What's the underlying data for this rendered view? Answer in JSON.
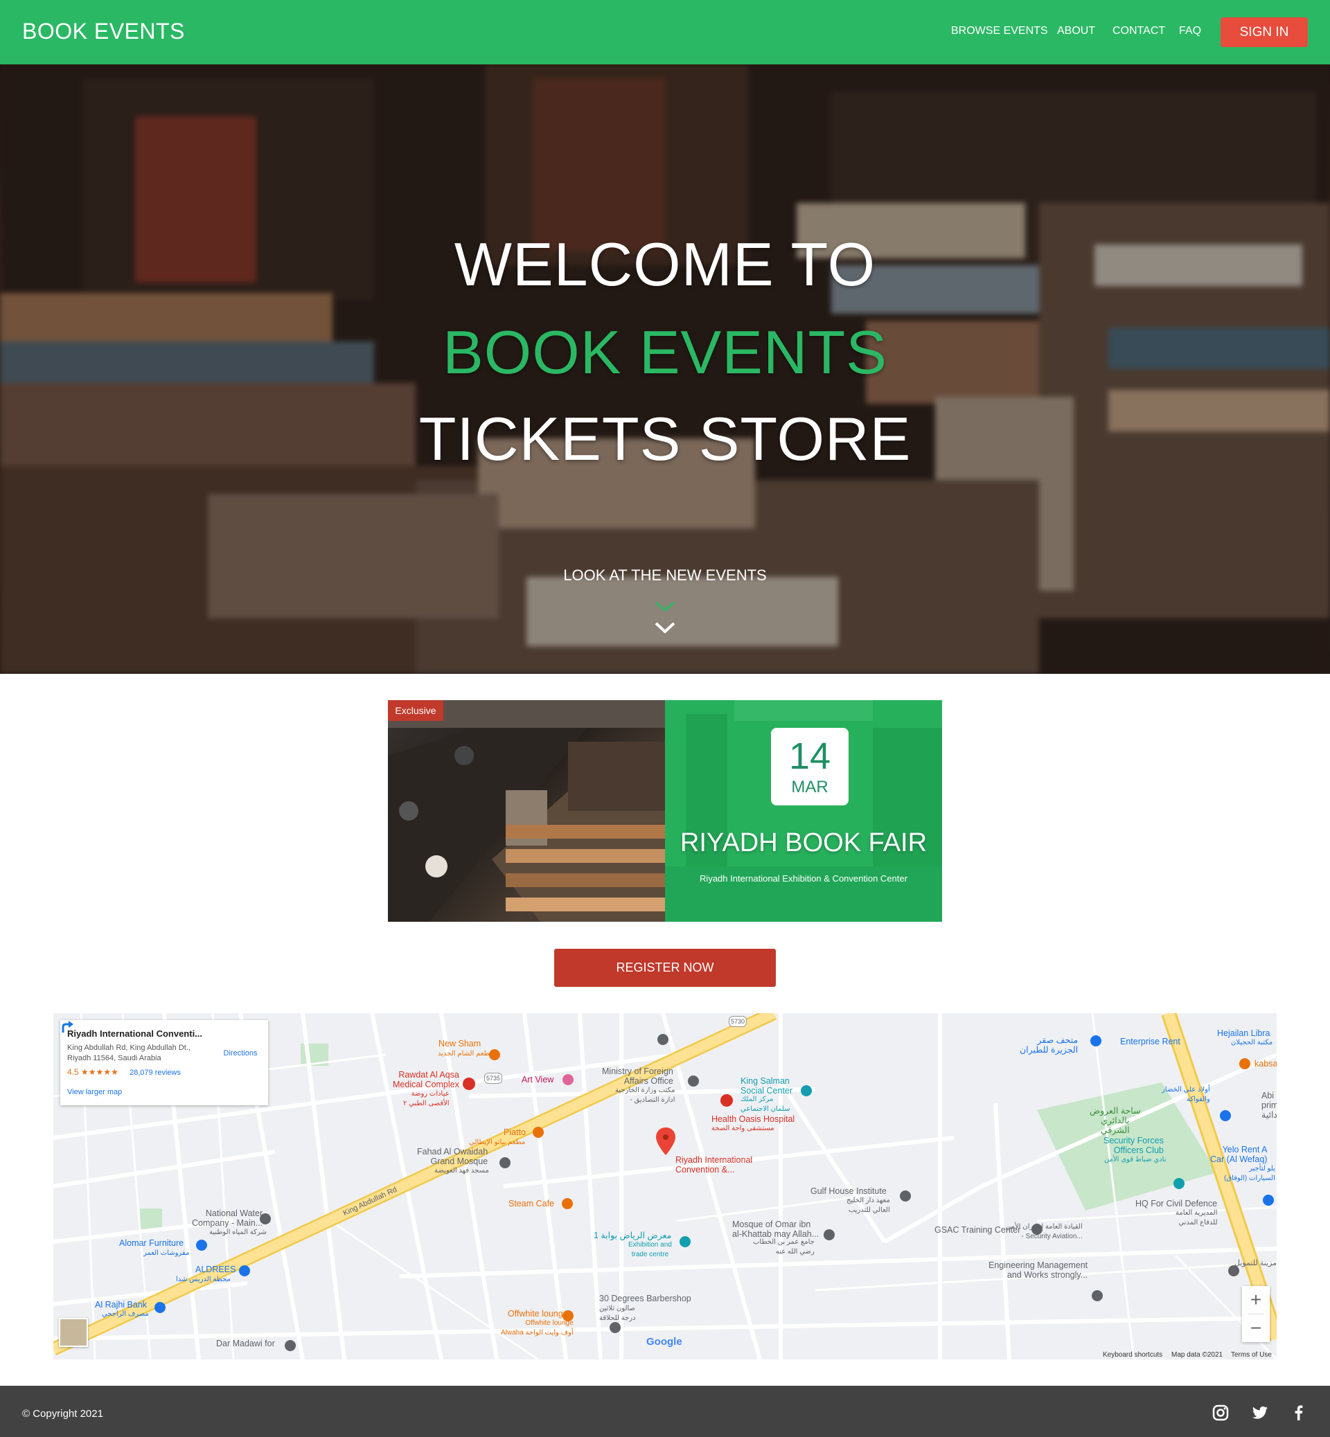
{
  "navbar": {
    "brand": "BOOK EVENTS",
    "links": [
      "BROWSE EVENTS",
      "ABOUT",
      "CONTACT",
      "FAQ"
    ],
    "signin_label": "SIGN IN",
    "color": "#2bb864",
    "signin_color": "#e74c3c"
  },
  "hero": {
    "line1": "WELCOME TO",
    "line2": "BOOK EVENTS",
    "line3": "TICKETS STORE",
    "subtitle": "LOOK AT THE NEW EVENTS",
    "accent": "#2bb864",
    "chevron_icon": "chevron-down-icon"
  },
  "event": {
    "badge": "Exclusive",
    "day": "14",
    "month": "MAR",
    "title": "RIYADH BOOK FAIR",
    "venue": "Riyadh International Exhibition & Convention Center",
    "color": "#27b05c"
  },
  "register_label": "REGISTER NOW",
  "map": {
    "place_title": "Riyadh International Conventi...",
    "address_line1": "King Abdullah Rd, King Abdullah Dt.,",
    "address_line2": "Riyadh 11564, Saudi Arabia",
    "rating": "4.5",
    "stars": "★★★★★",
    "reviews": "28,079 reviews",
    "larger_map": "View larger map",
    "directions": "Directions",
    "zoom_in": "+",
    "zoom_out": "−",
    "keyboard": "Keyboard shortcuts",
    "map_data": "Map data ©2021",
    "terms": "Terms of Use",
    "google": "Google",
    "labels": {
      "new_sham": "New Sham",
      "new_sham_ar": "مطعم الشام الجديد",
      "rawdat": "Rawdat Al Aqsa\nMedical Complex",
      "rawdat_ar": "عيادات روضة\nالأقصى الطبي ٢",
      "art_view": "Art View",
      "ministry": "Ministry of Foreign\nAffairs Office",
      "ministry_ar": "مكتب وزارة الخارجية\n- ادارة التصاديق",
      "king_salman": "King Salman\nSocial Center",
      "king_salman_ar": "مركز الملك\nسلمان الاجتماعي",
      "health_oasis": "Health Oasis Hospital",
      "health_oasis_ar": "مستشفى واحة الصحة",
      "piatto": "Piatto",
      "piatto_ar": "مطعم بياتو الإيطالي",
      "fahad": "Fahad Al Owaidah\nGrand Mosque",
      "fahad_ar": "مسجد فهد العويضة",
      "riyadh_intl": "Riyadh International\nConvention &...",
      "gulf_house": "Gulf House Institute",
      "gulf_house_ar": "معهد دار الخليج\nالعالي للتدريب",
      "steam_cafe": "Steam Cafe",
      "national_water": "National Water\nCompany - Main...",
      "national_water_ar": "شركة المياه الوطنية",
      "mosque_omar": "Mosque of Omar ibn\nal-Khattab may Allah...",
      "mosque_omar_ar": "جامع عمر بن الخطاب\nرضي الله عنه",
      "gsac": "GSAC Training Center",
      "exhibition_ar": "معرض الرياض بوابة 1",
      "exhibition": "Exhibition and\ntrade centre",
      "alomar": "Alomar Furniture",
      "alomar_ar": "مفروشات العمر",
      "aldrees": "ALDREES",
      "aldrees_ar": "محطة الدريس شدا",
      "al_rajhi": "Al Rajhi Bank",
      "al_rajhi_ar": "مصرف الراجحي",
      "barbershop": "30 Degrees Barbershop",
      "barbershop_ar": "صالون ثلاثين\nدرجة للحلاقة",
      "offwhite": "Offwhite lounge",
      "offwhite_sub": "Offwhite lounge\nAlwaha أوف وايت الواحة",
      "dar_madawi": "Dar Madawi for",
      "enterprise": "Enterprise Rent",
      "hejailan": "Hejailan Libra",
      "hejailan_ar": "مكتبة الحجيلان",
      "jazeera_ar": "متحف صقر\nالجزيرة للطيران",
      "kabsa": "kabsa",
      "kabsa_ar": "أولاد علي الخضار\nوالفواكه",
      "abi": "Abi l\nprim\nابتدائية",
      "sahat_ar": "ساحة العروض\nبالدائري\nالشرقي",
      "security": "Security Forces\nOfficers Club",
      "security_ar": "نادي ضباط قوى الأمن",
      "yelo": "Yelo Rent A\nCar (Al Wefaq)",
      "yelo_ar": "يلو لتأجير\nالسيارات (الوفاق)",
      "hq_civil": "HQ For Civil Defence",
      "hq_civil_ar": "المديرية العامة\nللدفاع المدني",
      "aviation_ar": "القيادة العامة لطيران الأمن\n- Security Aviation...",
      "engineering": "Engineering Management\nand Works strongly...",
      "engineering_ar": "مزينة للتمويل",
      "king_abdullah_rd": "King Abdullah Rd",
      "road_5730": "5730",
      "road_5735": "5735"
    },
    "colors": {
      "land": "#eef0f3",
      "park": "#c8e6c9",
      "highway": "#fde293",
      "highway_edge": "#f2c94c",
      "road": "#ffffff",
      "poi_orange": "#e8710a",
      "poi_red": "#d93025",
      "poi_blue": "#1a73e8",
      "poi_teal": "#129eaf",
      "poi_grey": "#5f6368"
    }
  },
  "footer": {
    "copyright": "© Copyright 2021",
    "social": [
      "instagram-icon",
      "twitter-icon",
      "facebook-icon"
    ],
    "color": "#424242"
  }
}
